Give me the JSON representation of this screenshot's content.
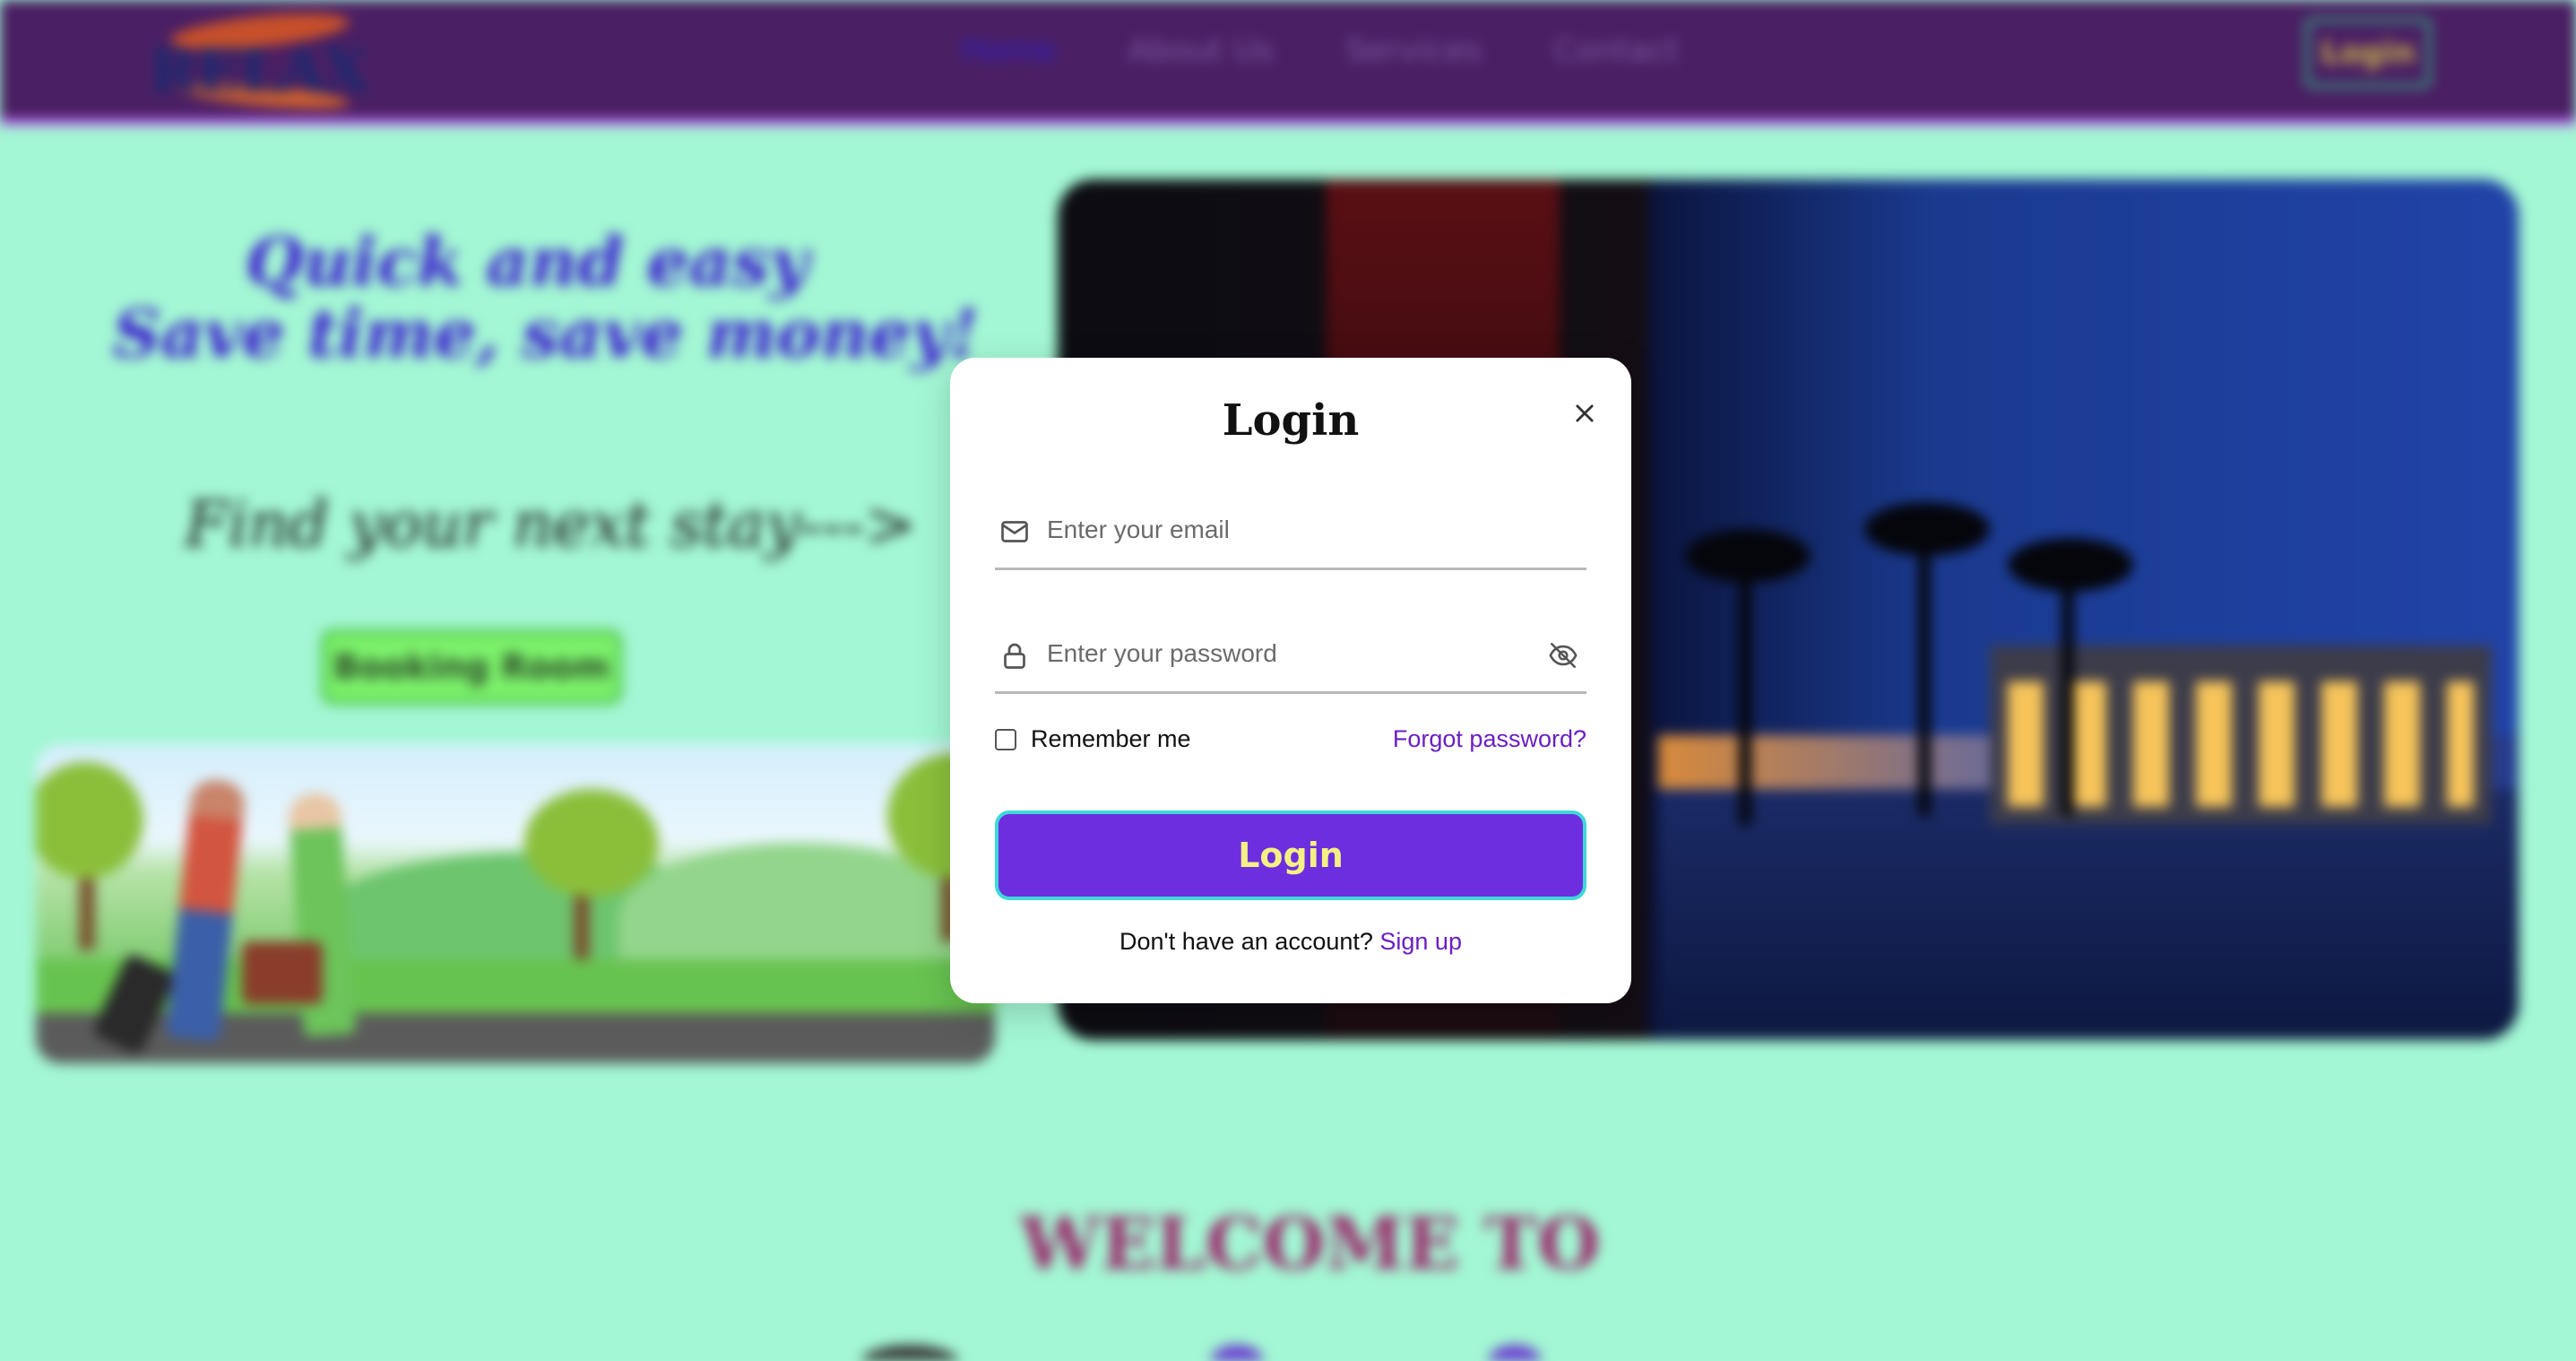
{
  "navbar": {
    "logo_text": "RELAX",
    "links": [
      "Home",
      "About Us",
      "Services",
      "Contact"
    ],
    "active_link": "Home",
    "login_label": "Login"
  },
  "hero": {
    "line1": "Quick and easy",
    "line2": "Save time, save money!",
    "tagline": "Find your next stay--->",
    "booking_button": "Booking Room"
  },
  "welcome": {
    "heading": "WELCOME TO"
  },
  "login_modal": {
    "title": "Login",
    "email": {
      "placeholder": "Enter your email",
      "value": ""
    },
    "password": {
      "placeholder": "Enter your password",
      "value": ""
    },
    "remember_label": "Remember me",
    "remember_checked": false,
    "forgot_label": "Forgot password?",
    "submit_label": "Login",
    "signup_prompt": "Don't have an account?",
    "signup_link": "Sign up"
  },
  "icons": {
    "email": "mail-icon",
    "password": "lock-icon",
    "toggle_visibility": "eye-off-icon",
    "close": "close-icon"
  },
  "colors": {
    "page_bg": "#a3f7d4",
    "navbar_bg": "#4a1f63",
    "primary_button": "#6d2ee0",
    "button_text": "#f4f083",
    "link": "#6a1fc2"
  }
}
